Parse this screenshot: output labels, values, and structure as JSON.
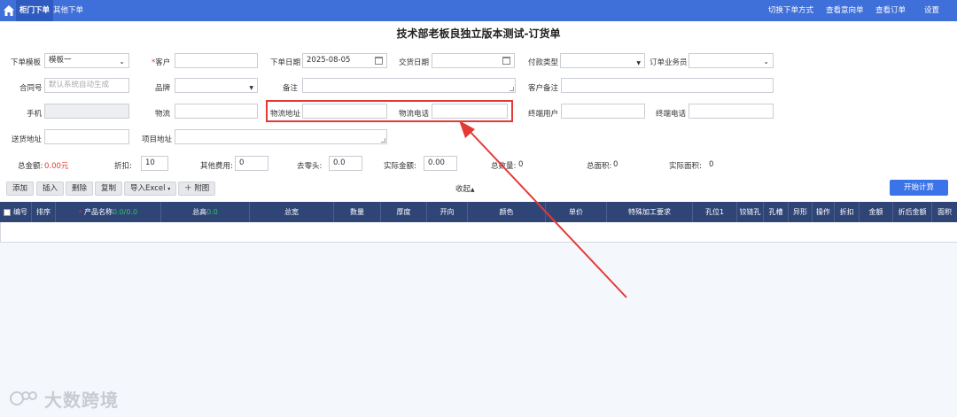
{
  "topbar": {
    "tabs": [
      {
        "label": "柜门下单",
        "active": true
      },
      {
        "label": "其他下单",
        "active": false
      }
    ],
    "right_links": [
      "切换下单方式",
      "查看意向单",
      "查看订单",
      "设置"
    ]
  },
  "page": {
    "title": "技术部老板良独立版本测试-订货单"
  },
  "form": {
    "template_label": "下单模板",
    "template_value": "模板一",
    "customer_label": "客户",
    "customer_required": "*",
    "order_date_label": "下单日期",
    "order_date_value": "2025-08-05",
    "delivery_date_label": "交货日期",
    "payment_type_label": "付款类型",
    "salesperson_label": "订单业务员",
    "contract_label": "合同号",
    "contract_placeholder": "默认系统自动生成",
    "brand_label": "品牌",
    "remark_label": "备注",
    "customer_remark_label": "客户备注",
    "phone_label": "手机",
    "logistics_label": "物流",
    "logistics_address_label": "物流地址",
    "logistics_phone_label": "物流电话",
    "end_user_label": "终端用户",
    "end_phone_label": "终端电话",
    "delivery_address_label": "送货地址",
    "project_address_label": "项目地址"
  },
  "totals": {
    "total_amount_label": "总金额:",
    "total_amount_value": "0.00元",
    "discount_label": "折扣:",
    "discount_value": "10",
    "other_fee_label": "其他费用:",
    "other_fee_value": "0",
    "round_off_label": "去零头:",
    "round_off_value": "0.0",
    "actual_amount_label": "实际金额:",
    "actual_amount_value": "0.00",
    "total_qty_label": "总数量:",
    "total_qty_value": "0",
    "total_area_label": "总面积:",
    "total_area_value": "0",
    "actual_area_label": "实际面积:",
    "actual_area_value": "0"
  },
  "toolbar": {
    "add": "添加",
    "insert": "插入",
    "delete": "删除",
    "copy": "复制",
    "import_excel": "导入Excel",
    "attach_image": "附图",
    "collapse": "收起",
    "start_calc": "开始计算"
  },
  "table": {
    "columns": [
      "编号",
      "排序",
      "产品名称",
      "总高",
      "总宽",
      "数量",
      "厚度",
      "开向",
      "颜色",
      "单价",
      "特殊加工要求",
      "孔位1",
      "铰链孔",
      "孔槽",
      "异形",
      "操作",
      "折扣",
      "金额",
      "折后金额",
      "面积"
    ],
    "product_name_suffix": "0.0/0.0",
    "total_height_suffix": "0.0"
  },
  "watermark": {
    "text": "大数跨境"
  },
  "colors": {
    "topbar": "#3f6fd8",
    "table_header": "#2f4576",
    "accent": "#3b74e8",
    "highlight": "#e53935"
  }
}
